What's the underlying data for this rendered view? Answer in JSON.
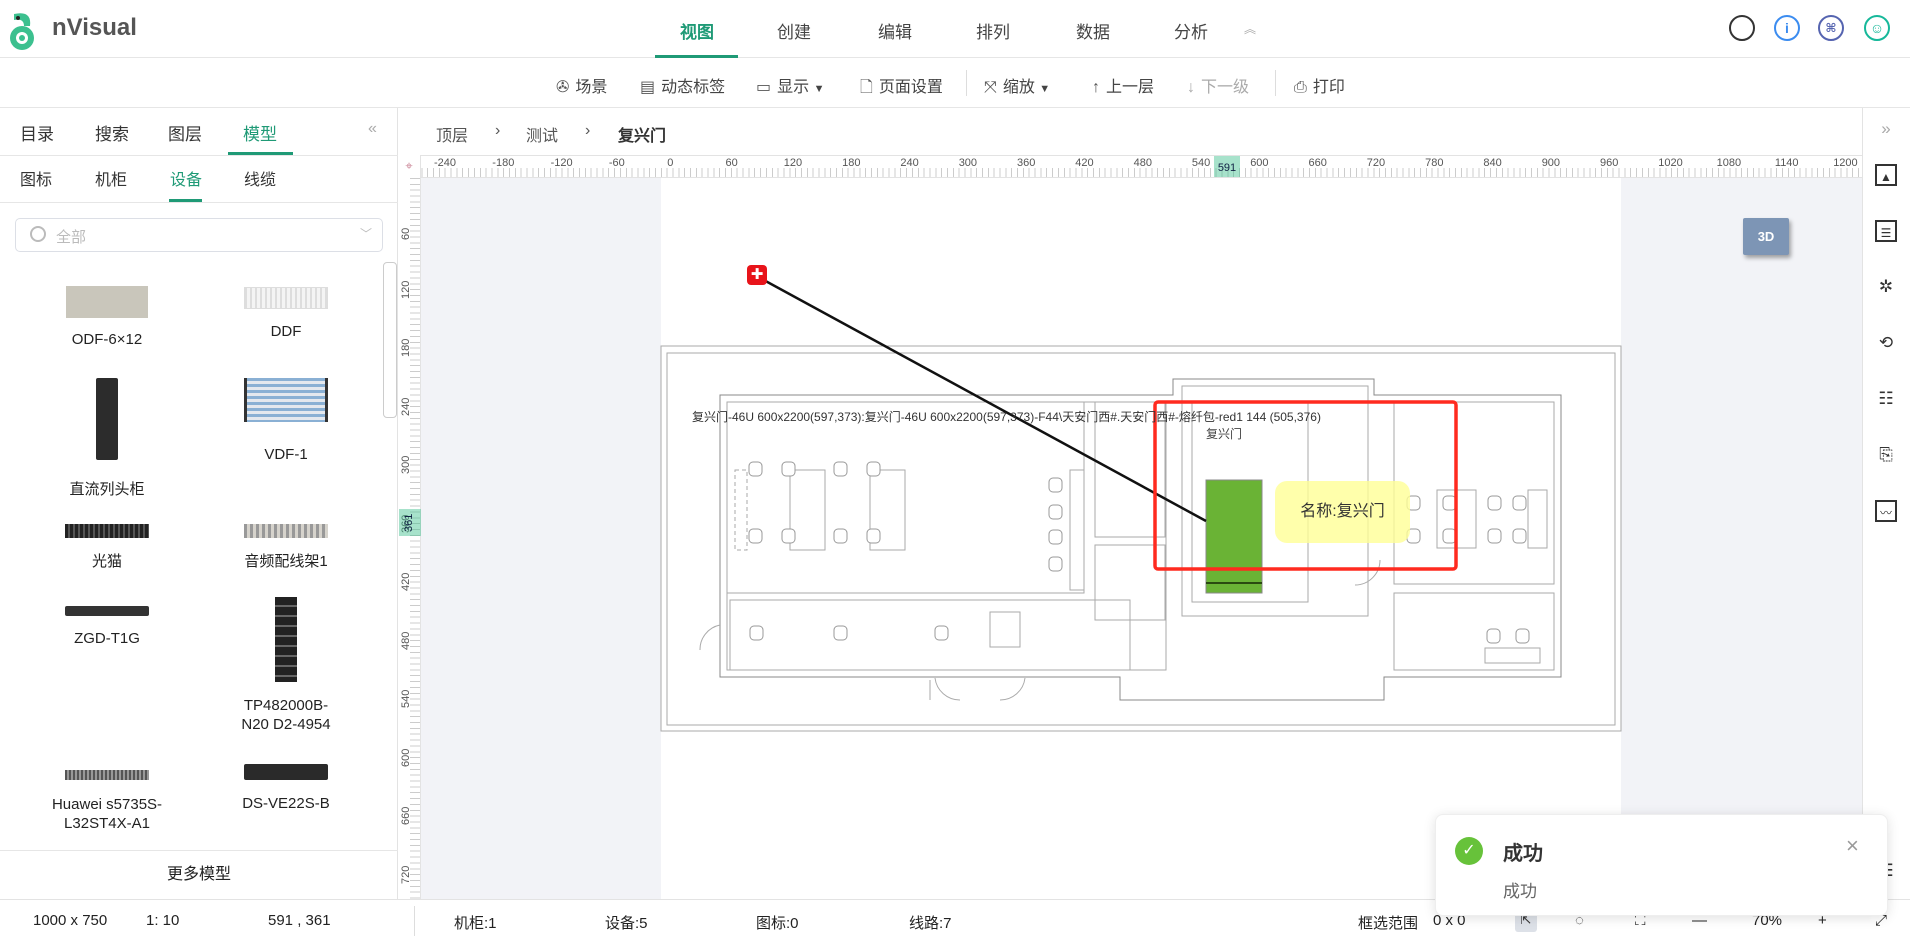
{
  "app": {
    "name": "nVisual"
  },
  "nav": {
    "tabs": [
      "视图",
      "创建",
      "编辑",
      "排列",
      "数据",
      "分析"
    ],
    "active": 0
  },
  "toolbar": {
    "scene": "场景",
    "dynamic_label": "动态标签",
    "display": "显示",
    "page_setup": "页面设置",
    "zoom": "缩放",
    "up_level": "上一层",
    "down_level": "下一级",
    "print": "打印"
  },
  "left_panel": {
    "tabs": [
      "目录",
      "搜索",
      "图层",
      "模型"
    ],
    "subtabs": [
      "图标",
      "机柜",
      "设备",
      "线缆"
    ],
    "search_placeholder": "全部",
    "items": [
      {
        "name": "ODF-6×12"
      },
      {
        "name": "DDF"
      },
      {
        "name": "直流列头柜"
      },
      {
        "name": "VDF-1"
      },
      {
        "name": "光猫"
      },
      {
        "name": "音频配线架1"
      },
      {
        "name": "ZGD-T1G"
      },
      {
        "name": "TP482000B-N20 D2-4954"
      },
      {
        "name": "Huawei s5735S-L32ST4X-A1"
      },
      {
        "name": "DS-VE22S-B"
      }
    ],
    "more": "更多模型"
  },
  "breadcrumb": [
    "顶层",
    "测试",
    "复兴门"
  ],
  "ruler": {
    "h_labels": [
      "-240",
      "-180",
      "-120",
      "-60",
      "0",
      "60",
      "120",
      "180",
      "240",
      "300",
      "360",
      "420",
      "480",
      "540",
      "600",
      "660",
      "720",
      "780",
      "840",
      "900",
      "960",
      "1020",
      "1080",
      "1140",
      "1200"
    ],
    "v_labels": [
      "60",
      "120",
      "180",
      "240",
      "300",
      "360",
      "420",
      "480",
      "540",
      "600",
      "660",
      "720"
    ],
    "cursor_x": "591",
    "cursor_y": "361"
  },
  "canvas": {
    "link_label": "复兴门-46U 600x2200(597,373):复兴门-46U 600x2200(597,373)-F44\\天安门西#.天安门西#-熔纤包-red1 144 (505,376)",
    "rack_label": "复兴门",
    "tooltip": "名称:复兴门",
    "btn_3d": "3D"
  },
  "toast": {
    "title": "成功",
    "message": "成功"
  },
  "status": {
    "page_size": "1000 x 750",
    "scale": "1: 10",
    "cursor": "591 , 361",
    "racks": "机柜:1",
    "devices": "设备:5",
    "icons": "图标:0",
    "links": "线路:7",
    "selection_label": "框选范围",
    "selection": "0 x 0",
    "zoom": "70%"
  },
  "colors": {
    "accent": "#1f9a76",
    "selection": "#ff2a1f",
    "rack": "#6ab335"
  }
}
